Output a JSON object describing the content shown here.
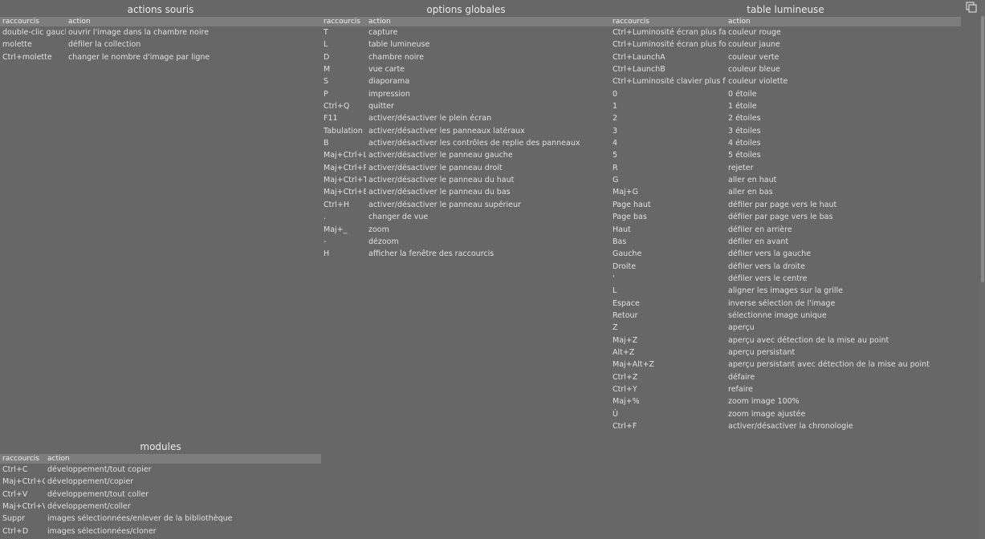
{
  "colors": {
    "background": "#676767",
    "header_row": "#7d7d7d",
    "text": "#e0e0e0"
  },
  "icons": {
    "detach": "detach-window-icon"
  },
  "sections": {
    "mouse": {
      "title": "actions souris",
      "columns": [
        "raccourcis",
        "action"
      ],
      "rows": [
        [
          "double-clic gauche",
          "ouvrir l'image dans la chambre noire"
        ],
        [
          "molette",
          "défiler la collection"
        ],
        [
          "Ctrl+molette",
          "changer le nombre d'image par ligne"
        ]
      ]
    },
    "global": {
      "title": "options globales",
      "columns": [
        "raccourcis",
        "action"
      ],
      "rows": [
        [
          "T",
          "capture"
        ],
        [
          "L",
          "table lumineuse"
        ],
        [
          "D",
          "chambre noire"
        ],
        [
          "M",
          "vue carte"
        ],
        [
          "S",
          "diaporama"
        ],
        [
          "P",
          "impression"
        ],
        [
          "Ctrl+Q",
          "quitter"
        ],
        [
          "F11",
          "activer/désactiver le plein écran"
        ],
        [
          "Tabulation",
          "activer/désactiver les panneaux latéraux"
        ],
        [
          "B",
          "activer/désactiver les contrôles de replie des panneaux"
        ],
        [
          "Maj+Ctrl+L",
          "activer/désactiver le panneau gauche"
        ],
        [
          "Maj+Ctrl+R",
          "activer/désactiver le panneau droit"
        ],
        [
          "Maj+Ctrl+T",
          "activer/désactiver le panneau du haut"
        ],
        [
          "Maj+Ctrl+B",
          "activer/désactiver le panneau du bas"
        ],
        [
          "Ctrl+H",
          "activer/désactiver le panneau supérieur"
        ],
        [
          ".",
          "changer de vue"
        ],
        [
          "Maj+_",
          "zoom"
        ],
        [
          "-",
          "dézoom"
        ],
        [
          "H",
          "afficher la fenêtre des raccourcis"
        ]
      ]
    },
    "lighttable": {
      "title": "table lumineuse",
      "columns": [
        "raccourcis",
        "action"
      ],
      "rows": [
        [
          "Ctrl+Luminosité écran plus faible",
          "couleur rouge"
        ],
        [
          "Ctrl+Luminosité écran plus forte",
          "couleur jaune"
        ],
        [
          "Ctrl+LaunchA",
          "couleur verte"
        ],
        [
          "Ctrl+LaunchB",
          "couleur bleue"
        ],
        [
          "Ctrl+Luminosité clavier plus faible",
          "couleur violette"
        ],
        [
          "0",
          "0 étoile"
        ],
        [
          "1",
          "1 étoile"
        ],
        [
          "2",
          "2 étoiles"
        ],
        [
          "3",
          "3 étoiles"
        ],
        [
          "4",
          "4 étoiles"
        ],
        [
          "5",
          "5 étoiles"
        ],
        [
          "R",
          "rejeter"
        ],
        [
          "G",
          "aller en haut"
        ],
        [
          "Maj+G",
          "aller en bas"
        ],
        [
          "Page haut",
          "défiler par page vers le haut"
        ],
        [
          "Page bas",
          "défiler par page vers le bas"
        ],
        [
          "Haut",
          "défiler en arrière"
        ],
        [
          "Bas",
          "défiler en avant"
        ],
        [
          "Gauche",
          "défiler vers la gauche"
        ],
        [
          "Droite",
          "défiler vers la droite"
        ],
        [
          "'",
          "défiler vers le centre"
        ],
        [
          "L",
          "aligner les images sur la grille"
        ],
        [
          "Espace",
          "inverse sélection de l'image"
        ],
        [
          "Retour",
          "sélectionne image unique"
        ],
        [
          "Z",
          "aperçu"
        ],
        [
          "Maj+Z",
          "aperçu avec détection de la mise au point"
        ],
        [
          "Alt+Z",
          "aperçu persistant"
        ],
        [
          "Maj+Alt+Z",
          "aperçu persistant avec détection de la mise au point"
        ],
        [
          "Ctrl+Z",
          "défaire"
        ],
        [
          "Ctrl+Y",
          "refaire"
        ],
        [
          "Maj+%",
          "zoom image 100%"
        ],
        [
          "Ù",
          "zoom image ajustée"
        ],
        [
          "Ctrl+F",
          "activer/désactiver la chronologie"
        ]
      ]
    },
    "modules": {
      "title": "modules",
      "columns": [
        "raccourcis",
        "action"
      ],
      "rows": [
        [
          "Ctrl+C",
          "développement/tout copier"
        ],
        [
          "Maj+Ctrl+C",
          "développement/copier"
        ],
        [
          "Ctrl+V",
          "développement/tout coller"
        ],
        [
          "Maj+Ctrl+V",
          "développement/coller"
        ],
        [
          "Suppr",
          "images sélectionnées/enlever de la bibliothèque"
        ],
        [
          "Ctrl+D",
          "images sélectionnées/cloner"
        ]
      ]
    }
  }
}
